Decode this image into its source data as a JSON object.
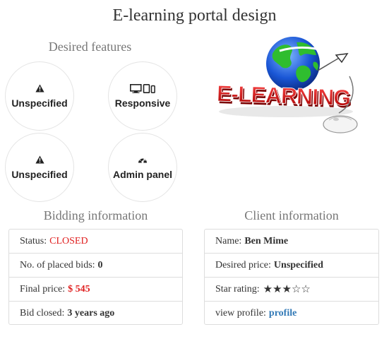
{
  "page": {
    "title": "E-learning portal design"
  },
  "features": {
    "heading": "Desired features",
    "items": [
      {
        "label": "Unspecified",
        "icon": "warning-icon"
      },
      {
        "label": "Responsive",
        "icon": "devices-icon"
      },
      {
        "label": "Unspecified",
        "icon": "warning-icon"
      },
      {
        "label": "Admin panel",
        "icon": "dashboard-icon"
      }
    ]
  },
  "logo": {
    "text": "E-LEARNING"
  },
  "bidding": {
    "heading": "Bidding information",
    "status_label": "Status:",
    "status_value": "CLOSED",
    "bids_label": "No. of placed bids:",
    "bids_value": "0",
    "final_price_label": "Final price:",
    "final_price_value": "$ 545",
    "closed_label": "Bid closed:",
    "closed_value": "3 years ago"
  },
  "client": {
    "heading": "Client information",
    "name_label": "Name:",
    "name_value": "Ben Mime",
    "desired_price_label": "Desired price:",
    "desired_price_value": "Unspecified",
    "rating_label": "Star rating:",
    "rating": {
      "value": 3,
      "max": 5
    },
    "profile_label": "view profile:",
    "profile_link": "profile"
  },
  "colors": {
    "closed": "#e02020",
    "link": "#337ab7"
  }
}
